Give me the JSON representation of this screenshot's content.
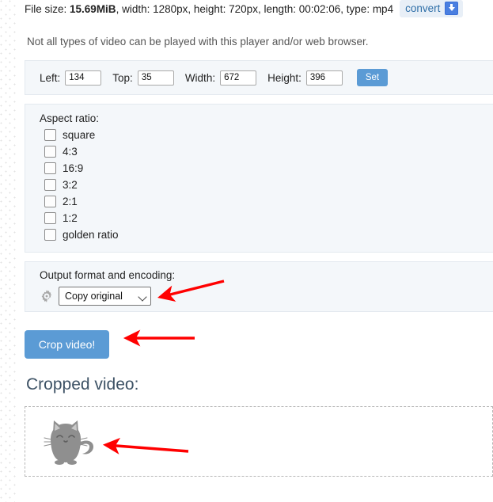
{
  "file_info": {
    "label_file_size": "File size:",
    "size": "15.69MiB",
    "width": ", width: 1280px",
    "height": ", height: 720px",
    "length": ", length: 00:02:06",
    "type": ", type: mp4",
    "convert_label": "convert",
    "download_icon": "download-icon"
  },
  "notice": "Not all types of video can be played with this player and/or web browser.",
  "crop_fields": {
    "left_label": "Left:",
    "left_value": "134",
    "top_label": "Top:",
    "top_value": "35",
    "width_label": "Width:",
    "width_value": "672",
    "height_label": "Height:",
    "height_value": "396",
    "set_label": "Set"
  },
  "aspect_ratio": {
    "title": "Aspect ratio:",
    "options": [
      {
        "label": "square",
        "checked": false
      },
      {
        "label": "4:3",
        "checked": false
      },
      {
        "label": "16:9",
        "checked": false
      },
      {
        "label": "3:2",
        "checked": false
      },
      {
        "label": "2:1",
        "checked": false
      },
      {
        "label": "1:2",
        "checked": false
      },
      {
        "label": "golden ratio",
        "checked": false
      }
    ]
  },
  "output": {
    "title": "Output format and encoding:",
    "gear_icon": "gear-icon",
    "selected": "Copy original",
    "options": [
      "Copy original"
    ]
  },
  "actions": {
    "crop_label": "Crop video!"
  },
  "result": {
    "title": "Cropped video:",
    "preview_icon": "cat-illustration"
  },
  "annotations": {
    "arrow_color": "#ff0000",
    "arrows": [
      {
        "name": "arrow-to-format-select"
      },
      {
        "name": "arrow-to-crop-button"
      },
      {
        "name": "arrow-to-cropped-preview"
      }
    ]
  },
  "colors": {
    "panel_bg": "#f4f7fa",
    "button_blue": "#5b9bd5",
    "convert_bg": "#e8eff7",
    "heading": "#3d5265"
  }
}
